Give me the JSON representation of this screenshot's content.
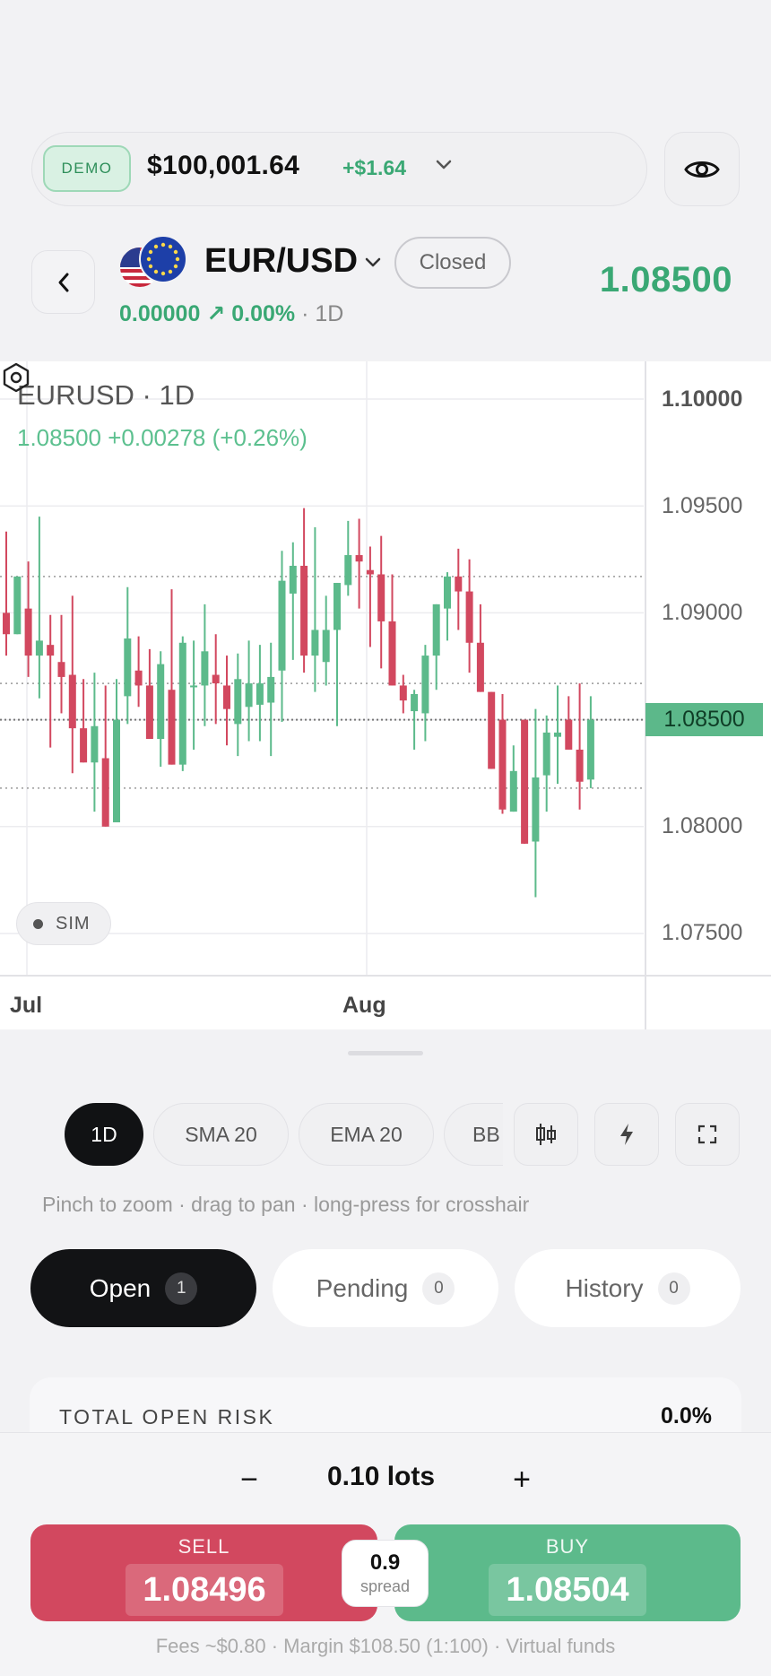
{
  "account": {
    "mode_badge": "DEMO",
    "balance": "$100,001.64",
    "pnl": "+$1.64"
  },
  "instrument": {
    "symbol": "EUR/USD",
    "status": "Closed",
    "price": "1.08500",
    "change": "0.00000",
    "change_pct": "↗ 0.00%",
    "timeframe": "· 1D"
  },
  "chart": {
    "title": "EURUSD · 1D",
    "ohlc_summary": "1.08500  +0.00278 (+0.26%)",
    "sim_badge": "SIM",
    "y_ticks": [
      "1.10000",
      "1.09500",
      "1.09000",
      "1.08500",
      "1.08000",
      "1.07500"
    ],
    "x_ticks": [
      "Jul",
      "Aug"
    ],
    "current_price_label": "1.08500"
  },
  "chart_data": {
    "type": "candlestick",
    "title": "EURUSD · 1D",
    "ylim": [
      1.073,
      1.1027
    ],
    "last_price": 1.085,
    "horizontal_lines": [
      1.0917,
      1.0867,
      1.0818
    ],
    "x_tick_labels": [
      "Jul",
      "Aug"
    ],
    "candles": [
      {
        "o": 1.09,
        "h": 1.0938,
        "l": 1.088,
        "c": 1.089
      },
      {
        "o": 1.089,
        "h": 1.0915,
        "l": 1.09,
        "c": 1.0917
      },
      {
        "o": 1.0902,
        "h": 1.0924,
        "l": 1.087,
        "c": 1.088
      },
      {
        "o": 1.088,
        "h": 1.0945,
        "l": 1.086,
        "c": 1.0887
      },
      {
        "o": 1.0885,
        "h": 1.0899,
        "l": 1.0837,
        "c": 1.088
      },
      {
        "o": 1.0877,
        "h": 1.0899,
        "l": 1.0853,
        "c": 1.087
      },
      {
        "o": 1.0871,
        "h": 1.0908,
        "l": 1.0825,
        "c": 1.0846
      },
      {
        "o": 1.0846,
        "h": 1.0869,
        "l": 1.0834,
        "c": 1.083
      },
      {
        "o": 1.083,
        "h": 1.0872,
        "l": 1.0807,
        "c": 1.0847
      },
      {
        "o": 1.0832,
        "h": 1.0866,
        "l": 1.0802,
        "c": 1.08
      },
      {
        "o": 1.0802,
        "h": 1.0869,
        "l": 1.0817,
        "c": 1.085
      },
      {
        "o": 1.0861,
        "h": 1.0912,
        "l": 1.0848,
        "c": 1.0888
      },
      {
        "o": 1.0873,
        "h": 1.0889,
        "l": 1.0856,
        "c": 1.0866
      },
      {
        "o": 1.0866,
        "h": 1.0883,
        "l": 1.0844,
        "c": 1.0841
      },
      {
        "o": 1.0841,
        "h": 1.0882,
        "l": 1.0828,
        "c": 1.0876
      },
      {
        "o": 1.0864,
        "h": 1.0911,
        "l": 1.0833,
        "c": 1.0829
      },
      {
        "o": 1.0829,
        "h": 1.0889,
        "l": 1.0826,
        "c": 1.0886
      },
      {
        "o": 1.0866,
        "h": 1.0887,
        "l": 1.0836,
        "c": 1.0866
      },
      {
        "o": 1.0866,
        "h": 1.0904,
        "l": 1.0847,
        "c": 1.0882
      },
      {
        "o": 1.0871,
        "h": 1.089,
        "l": 1.0848,
        "c": 1.0867
      },
      {
        "o": 1.0866,
        "h": 1.088,
        "l": 1.0838,
        "c": 1.0855
      },
      {
        "o": 1.0848,
        "h": 1.0881,
        "l": 1.0833,
        "c": 1.0869
      },
      {
        "o": 1.0856,
        "h": 1.0887,
        "l": 1.084,
        "c": 1.0867
      },
      {
        "o": 1.0857,
        "h": 1.0885,
        "l": 1.084,
        "c": 1.0867
      },
      {
        "o": 1.0858,
        "h": 1.0886,
        "l": 1.0833,
        "c": 1.087
      },
      {
        "o": 1.0873,
        "h": 1.0929,
        "l": 1.0849,
        "c": 1.0915
      },
      {
        "o": 1.0909,
        "h": 1.0933,
        "l": 1.0878,
        "c": 1.0922
      },
      {
        "o": 1.0922,
        "h": 1.0949,
        "l": 1.0872,
        "c": 1.088
      },
      {
        "o": 1.088,
        "h": 1.094,
        "l": 1.0863,
        "c": 1.0892
      },
      {
        "o": 1.0877,
        "h": 1.0908,
        "l": 1.0866,
        "c": 1.0892
      },
      {
        "o": 1.0892,
        "h": 1.0914,
        "l": 1.0847,
        "c": 1.0914
      },
      {
        "o": 1.0913,
        "h": 1.0943,
        "l": 1.0908,
        "c": 1.0927
      },
      {
        "o": 1.0927,
        "h": 1.0944,
        "l": 1.0902,
        "c": 1.0924
      },
      {
        "o": 1.092,
        "h": 1.0931,
        "l": 1.0884,
        "c": 1.0918
      },
      {
        "o": 1.0918,
        "h": 1.0936,
        "l": 1.0874,
        "c": 1.0896
      },
      {
        "o": 1.0896,
        "h": 1.0918,
        "l": 1.0871,
        "c": 1.0866
      },
      {
        "o": 1.0866,
        "h": 1.0871,
        "l": 1.0853,
        "c": 1.0859
      },
      {
        "o": 1.0854,
        "h": 1.0864,
        "l": 1.0836,
        "c": 1.0862
      },
      {
        "o": 1.0853,
        "h": 1.0885,
        "l": 1.084,
        "c": 1.088
      },
      {
        "o": 1.088,
        "h": 1.0904,
        "l": 1.0864,
        "c": 1.0904
      },
      {
        "o": 1.0902,
        "h": 1.0919,
        "l": 1.0887,
        "c": 1.0917
      },
      {
        "o": 1.0917,
        "h": 1.093,
        "l": 1.0892,
        "c": 1.091
      },
      {
        "o": 1.091,
        "h": 1.0925,
        "l": 1.0872,
        "c": 1.0886
      },
      {
        "o": 1.0886,
        "h": 1.0904,
        "l": 1.0863,
        "c": 1.0863
      },
      {
        "o": 1.0863,
        "h": 1.0855,
        "l": 1.0832,
        "c": 1.0827
      },
      {
        "o": 1.085,
        "h": 1.0862,
        "l": 1.0806,
        "c": 1.0808
      },
      {
        "o": 1.0807,
        "h": 1.0838,
        "l": 1.0836,
        "c": 1.0826
      },
      {
        "o": 1.085,
        "h": 1.0846,
        "l": 1.0802,
        "c": 1.0792
      },
      {
        "o": 1.0793,
        "h": 1.0855,
        "l": 1.0767,
        "c": 1.0823
      },
      {
        "o": 1.0824,
        "h": 1.0852,
        "l": 1.0807,
        "c": 1.0844
      },
      {
        "o": 1.0842,
        "h": 1.0866,
        "l": 1.082,
        "c": 1.0844
      },
      {
        "o": 1.085,
        "h": 1.0861,
        "l": 1.0837,
        "c": 1.0836
      },
      {
        "o": 1.0836,
        "h": 1.0867,
        "l": 1.0808,
        "c": 1.0821
      },
      {
        "o": 1.0822,
        "h": 1.0861,
        "l": 1.0818,
        "c": 1.085
      }
    ]
  },
  "toolbar": {
    "chips": [
      "1D",
      "SMA 20",
      "EMA 20",
      "BB"
    ],
    "hint": "Pinch to zoom · drag to pan · long-press for crosshair"
  },
  "tabs": [
    {
      "label": "Open",
      "count": "1"
    },
    {
      "label": "Pending",
      "count": "0"
    },
    {
      "label": "History",
      "count": "0"
    }
  ],
  "risk": {
    "label": "TOTAL OPEN RISK",
    "value": "0.0%"
  },
  "order": {
    "lots": "0.10 lots",
    "minus": "−",
    "plus": "+",
    "sell_label": "SELL",
    "sell_price": "1.08496",
    "buy_label": "BUY",
    "buy_price": "1.08504",
    "spread_value": "0.9",
    "spread_label": "spread",
    "footer": "Fees ~$0.80 · Margin $108.50 (1:100) · Virtual funds"
  },
  "colors": {
    "up": "#5cba8b",
    "down": "#d2485f",
    "accent_green": "#3aa874"
  }
}
